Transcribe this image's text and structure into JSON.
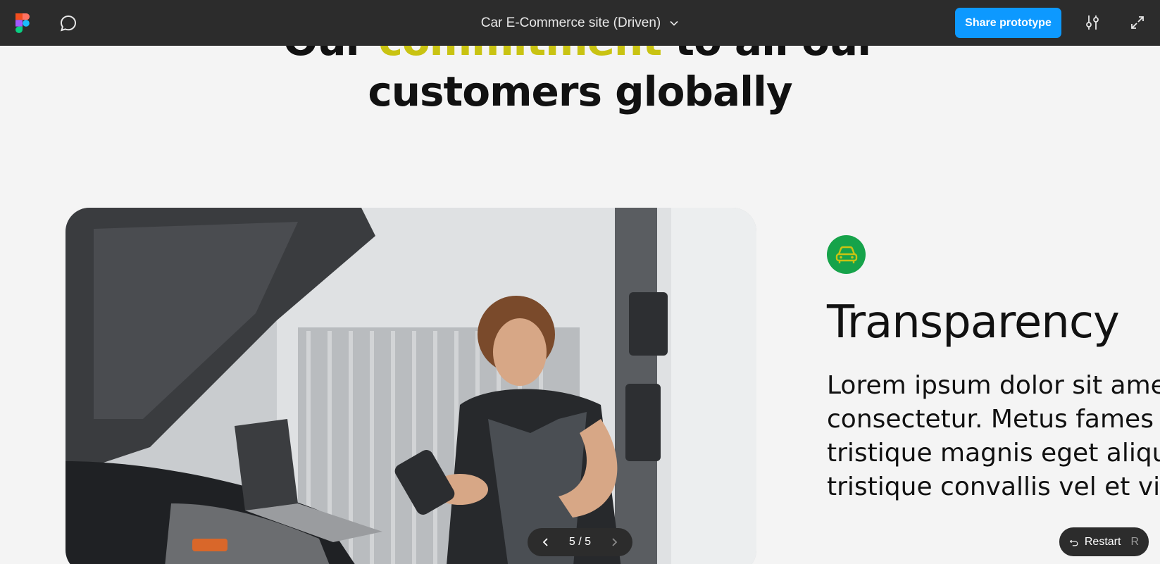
{
  "toolbar": {
    "title": "Car E-Commerce site (Driven)",
    "share_label": "Share prototype"
  },
  "page": {
    "heading_line1_pre": "Our ",
    "heading_line1_accent": "commitment",
    "heading_line1_post": " to all our",
    "heading_line2": "customers globally",
    "feature_title": "Transparency",
    "feature_body": [
      "Lorem ipsum dolor sit amet",
      "consectetur. Metus fames n",
      "tristique magnis eget aliqua",
      "tristique convallis vel et vita"
    ],
    "accent_color": "#c9c312",
    "icon_bg_color": "#16a34a"
  },
  "prototype_controls": {
    "page_indicator": "5 / 5",
    "restart_label": "Restart",
    "restart_key": "R"
  }
}
